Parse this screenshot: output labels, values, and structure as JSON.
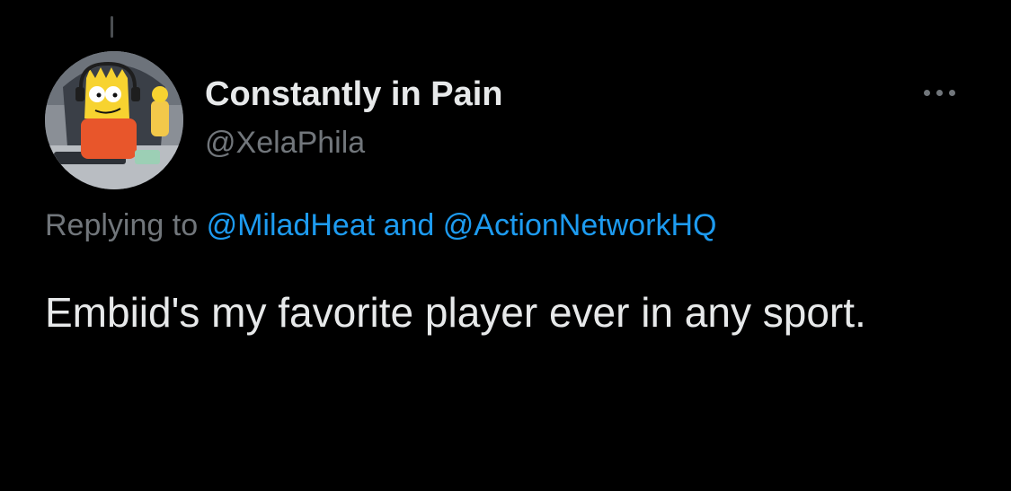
{
  "tweet": {
    "author": {
      "display_name": "Constantly in Pain",
      "handle": "@XelaPhila",
      "avatar_icon": "avatar-cartoon-gamer"
    },
    "more_icon": "ellipsis-icon",
    "reply": {
      "prefix": "Replying to",
      "mention_1": "@MiladHeat",
      "joiner": "and",
      "mention_2": "@ActionNetworkHQ"
    },
    "text": "Embiid's my favorite player ever in any sport."
  },
  "colors": {
    "background": "#000000",
    "primary_text": "#e7e9ea",
    "secondary_text": "#71767b",
    "link": "#1d9bf0"
  }
}
